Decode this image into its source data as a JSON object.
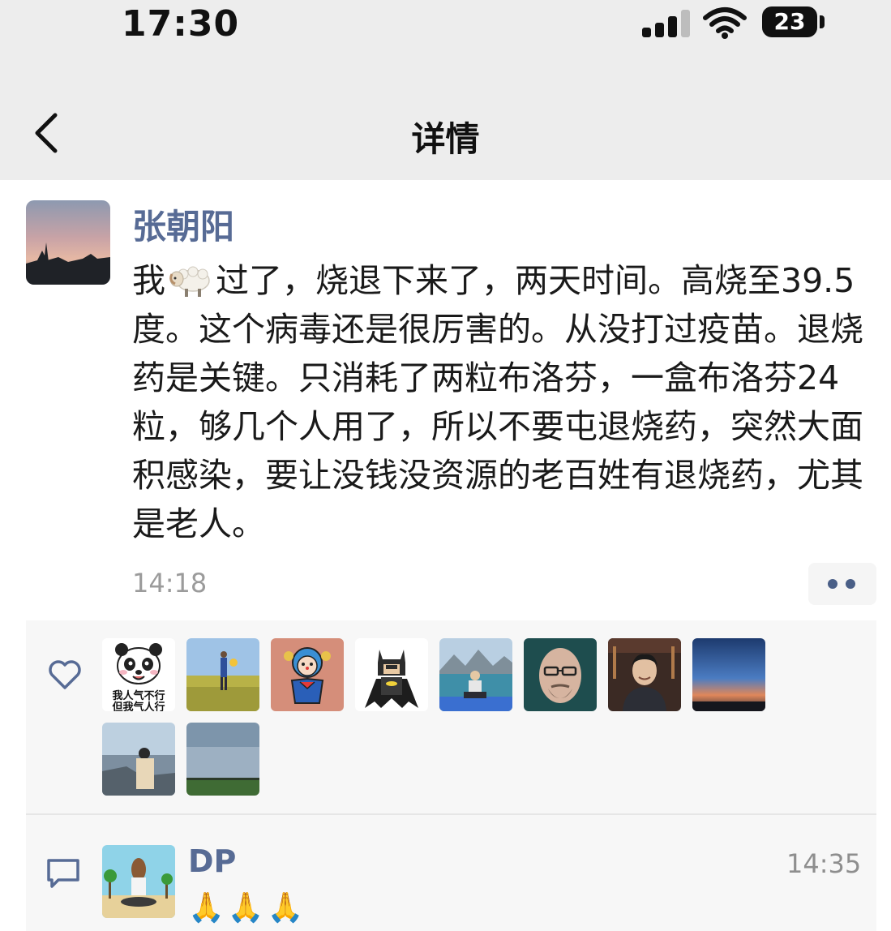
{
  "status_bar": {
    "time": "17:30",
    "battery": "23",
    "icons": [
      "signal-icon",
      "wifi-icon",
      "battery-icon"
    ]
  },
  "nav": {
    "title": "详情",
    "back_icon": "chevron-left-icon"
  },
  "post": {
    "author": "张朝阳",
    "content_before_emoji": "我",
    "emoji": "sheep-emoji",
    "content_after_emoji": "过了，烧退下来了，两天时间。高烧至39.5度。这个病毒还是很厉害的。从没打过疫苗。退烧药是关键。只消耗了两粒布洛芬，一盒布洛芬24粒，够几个人用了，所以不要屯退烧药，突然大面积感染，要让没钱没资源的老百姓有退烧药，尤其是老人。",
    "time": "14:18",
    "more_icon": "more-dots-icon",
    "avatar_icon": "sunset-landscape-avatar"
  },
  "likes": {
    "icon": "heart-icon",
    "avatars": [
      {
        "name": "panda-meme-avatar",
        "caption_line1": "我人气不行",
        "caption_line2": "但我气人行"
      },
      {
        "name": "field-person-avatar"
      },
      {
        "name": "cartoon-tattoo-avatar"
      },
      {
        "name": "batman-lego-avatar"
      },
      {
        "name": "lake-person-avatar"
      },
      {
        "name": "bald-man-portrait-avatar"
      },
      {
        "name": "young-man-avatar"
      },
      {
        "name": "dusk-sky-avatar"
      },
      {
        "name": "seaside-person-avatar"
      },
      {
        "name": "grassland-sky-avatar"
      }
    ]
  },
  "comments": {
    "icon": "comment-bubble-icon",
    "items": [
      {
        "name": "DP",
        "time": "14:35",
        "text": "🙏🙏🙏",
        "avatar": "cartoon-horse-avatar"
      }
    ]
  },
  "colors": {
    "link_name": "#576b95",
    "nav_bg": "#ededed",
    "panel_bg": "#f7f7f7",
    "meta_gray": "#9b9b9b"
  }
}
